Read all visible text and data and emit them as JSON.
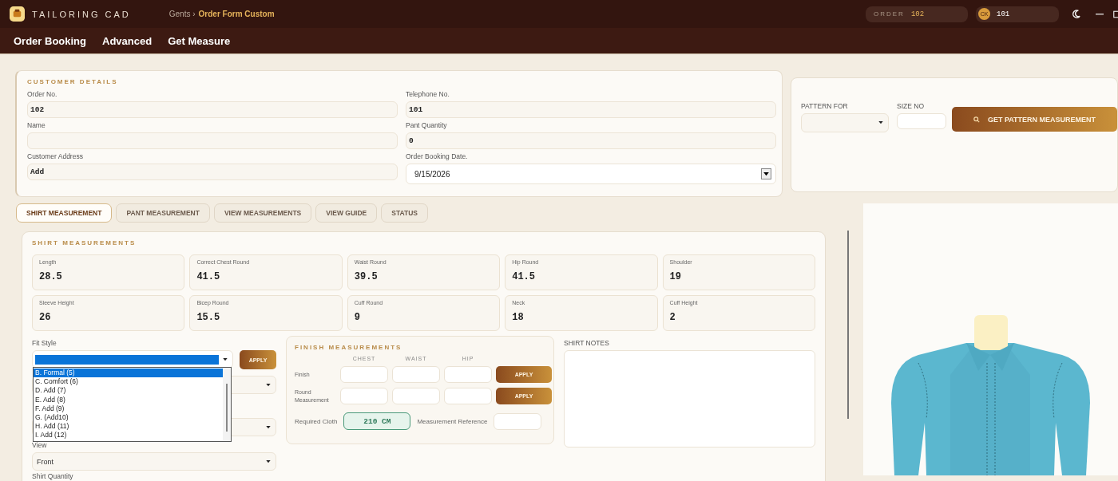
{
  "app": {
    "name": "TAILORING CAD",
    "breadcrumb": {
      "parent": "Gents ›",
      "current": "Order Form Custom"
    },
    "order_badge": {
      "label": "ORDER",
      "value": "102"
    },
    "user_badge": {
      "initials": "CK",
      "value": "101"
    }
  },
  "nav": [
    {
      "label": "Order Booking"
    },
    {
      "label": "Advanced"
    },
    {
      "label": "Get Measure"
    }
  ],
  "customer": {
    "title": "CUSTOMER DETAILS",
    "fields": [
      {
        "label": "Order No.",
        "value": "102",
        "kind": "text"
      },
      {
        "label": "Telephone No.",
        "value": "101",
        "kind": "text"
      },
      {
        "label": "Name",
        "kind": "text"
      },
      {
        "label": "Pant Quantity",
        "value": "0",
        "kind": "text"
      },
      {
        "label": "Customer Address",
        "value": "Add",
        "kind": "text"
      },
      {
        "label": "Order Booking Date.",
        "value": "9/15/2026",
        "kind": "date"
      }
    ]
  },
  "pattern": {
    "fields": [
      {
        "label": "PATTERN FOR",
        "kind": "select"
      },
      {
        "label": "SIZE NO",
        "kind": "input"
      }
    ],
    "button": "GET PATTERN MEASUREMENT"
  },
  "tabs": [
    {
      "label": "SHIRT MEASUREMENT",
      "selected": true
    },
    {
      "label": "PANT MEASUREMENT",
      "selected": false
    },
    {
      "label": "VIEW MEASUREMENTS",
      "selected": false
    },
    {
      "label": "VIEW GUIDE",
      "selected": false
    },
    {
      "label": "STATUS",
      "selected": false
    }
  ],
  "shirt": {
    "title": "SHIRT MEASUREMENTS",
    "measurements": [
      {
        "label": "Length",
        "value": "28.5"
      },
      {
        "label": "Correct Chest Round",
        "value": "41.5"
      },
      {
        "label": "Waist  Round",
        "value": "39.5"
      },
      {
        "label": "Hip Round",
        "value": "41.5"
      },
      {
        "label": "Shoulder",
        "value": "19"
      },
      {
        "label": "Sleeve Height",
        "value": "26"
      },
      {
        "label": "Bicep  Round",
        "value": "15.5"
      },
      {
        "label": "Cuff Round",
        "value": "9"
      },
      {
        "label": "Neck",
        "value": "18"
      },
      {
        "label": "Cuff Height",
        "value": "2"
      }
    ],
    "fit_style": {
      "label": "Fit Style",
      "open": true,
      "apply": "APPLY",
      "options": [
        {
          "label": "B. Formal (5)",
          "selected": true
        },
        {
          "label": "C. Comfort (6)",
          "selected": false
        },
        {
          "label": "D. Add (7)",
          "selected": false
        },
        {
          "label": "E. Add (8)",
          "selected": false
        },
        {
          "label": "F. Add (9)",
          "selected": false
        },
        {
          "label": "G. (Add10)",
          "selected": false
        },
        {
          "label": "H. Add (11)",
          "selected": false
        },
        {
          "label": "I. Add (12)",
          "selected": false
        }
      ]
    },
    "view": {
      "label": "View",
      "value": "Front"
    },
    "shirt_quantity_label": "Shirt Quantity"
  },
  "finish": {
    "title": "FINISH MEASUREMENTS",
    "columns": [
      "CHEST",
      "WAIST",
      "HIP"
    ],
    "rows": [
      {
        "label": "Finish",
        "button": "APPLY"
      },
      {
        "label": "Round Measurement",
        "button": "APPLY"
      }
    ],
    "required_cloth": {
      "label": "Required Cloth",
      "value": "210 CM"
    },
    "reference_label": "Measurement Reference"
  },
  "notes": {
    "label": "SHIRT NOTES"
  }
}
